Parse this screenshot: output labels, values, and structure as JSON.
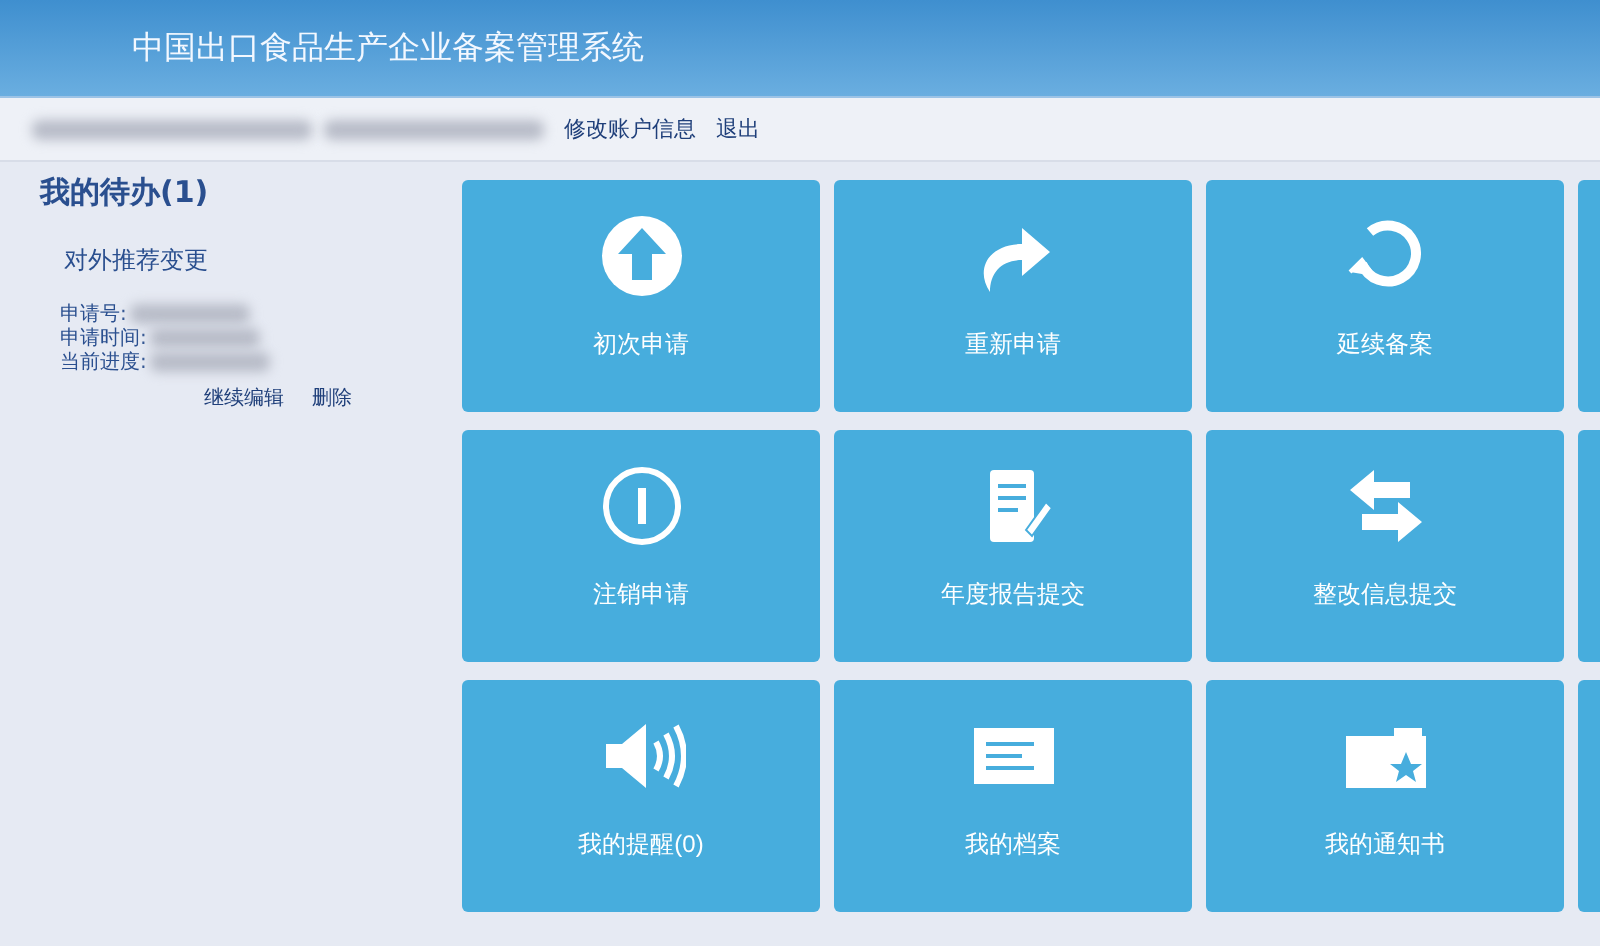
{
  "header": {
    "title": "中国出口食品生产企业备案管理系统"
  },
  "account_bar": {
    "links": [
      "修改账户信息",
      "退出"
    ]
  },
  "todo": {
    "heading": "我的待办(1)",
    "item": {
      "title": "对外推荐变更",
      "fields": [
        "申请号:",
        "申请时间:",
        "当前进度:"
      ],
      "actions": [
        "继续编辑",
        "删除"
      ]
    }
  },
  "tiles": [
    {
      "label": "初次申请"
    },
    {
      "label": "重新申请"
    },
    {
      "label": "延续备案"
    },
    {
      "kind": "partial"
    },
    {
      "label": "注销申请"
    },
    {
      "label": "年度报告提交"
    },
    {
      "label": "整改信息提交"
    },
    {
      "kind": "partial"
    },
    {
      "label": "我的提醒(0)"
    },
    {
      "label": "我的档案"
    },
    {
      "label": "我的通知书"
    },
    {
      "kind": "partial"
    }
  ]
}
